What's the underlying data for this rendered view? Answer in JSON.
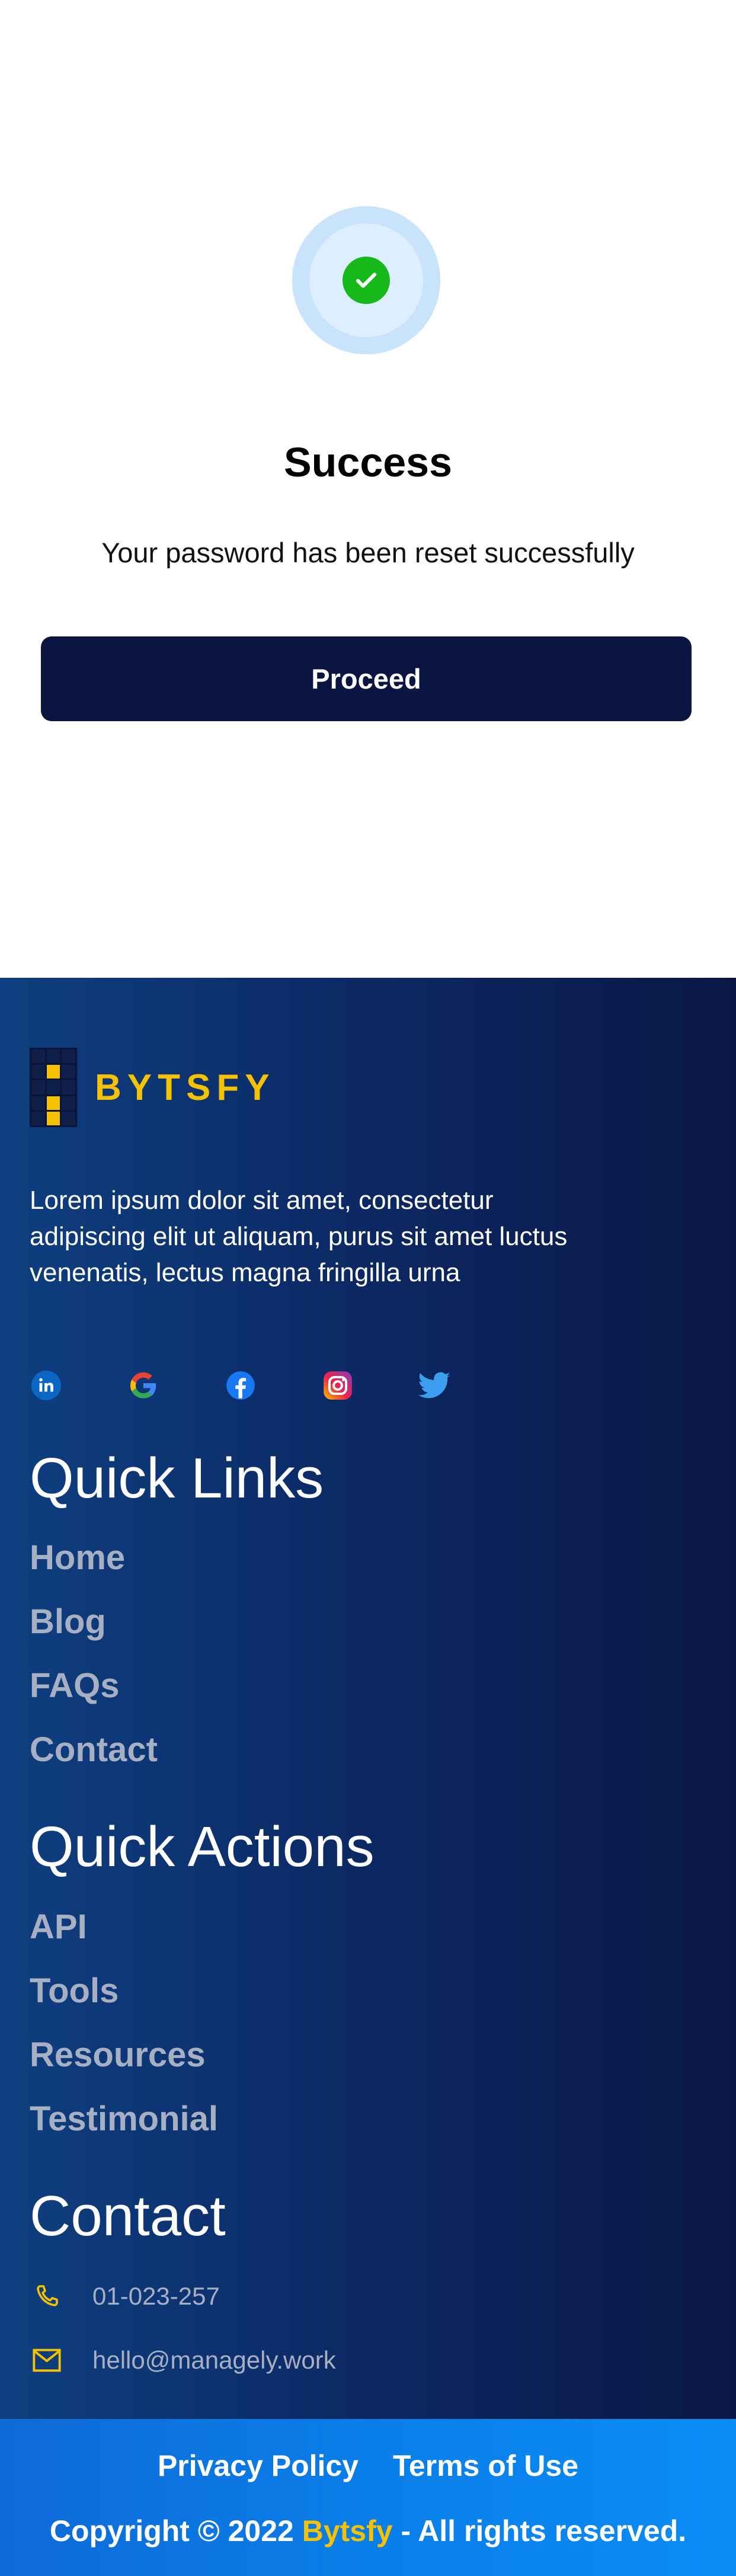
{
  "success": {
    "title": "Success",
    "message": "Your password has been reset successfully",
    "button_label": "Proceed"
  },
  "footer": {
    "brand": "BYTSFY",
    "about": "Lorem ipsum dolor sit amet, consectetur adipiscing elit ut aliquam, purus sit amet luctus venenatis, lectus magna fringilla urna",
    "socials": [
      "linkedin-icon",
      "google-icon",
      "facebook-icon",
      "instagram-icon",
      "twitter-icon"
    ],
    "quick_links": {
      "title": "Quick Links",
      "items": [
        "Home",
        "Blog",
        "FAQs",
        "Contact"
      ]
    },
    "quick_actions": {
      "title": "Quick Actions",
      "items": [
        "API",
        "Tools",
        "Resources",
        "Testimonial"
      ]
    },
    "contact": {
      "title": "Contact",
      "phone": "01-023-257",
      "email": "hello@managely.work"
    }
  },
  "bottom_bar": {
    "privacy": "Privacy Policy",
    "terms": "Terms of Use",
    "copyright_prefix": "Copyright © 2022",
    "copyright_brand": "Bytsfy",
    "copyright_suffix": "- All rights reserved."
  },
  "colors": {
    "primary_dark": "#0b1541",
    "success_green": "#17b91a",
    "brand_yellow": "#f5c200",
    "link_gray": "#a7afc3",
    "bottom_blue": "#0a7ee8"
  }
}
